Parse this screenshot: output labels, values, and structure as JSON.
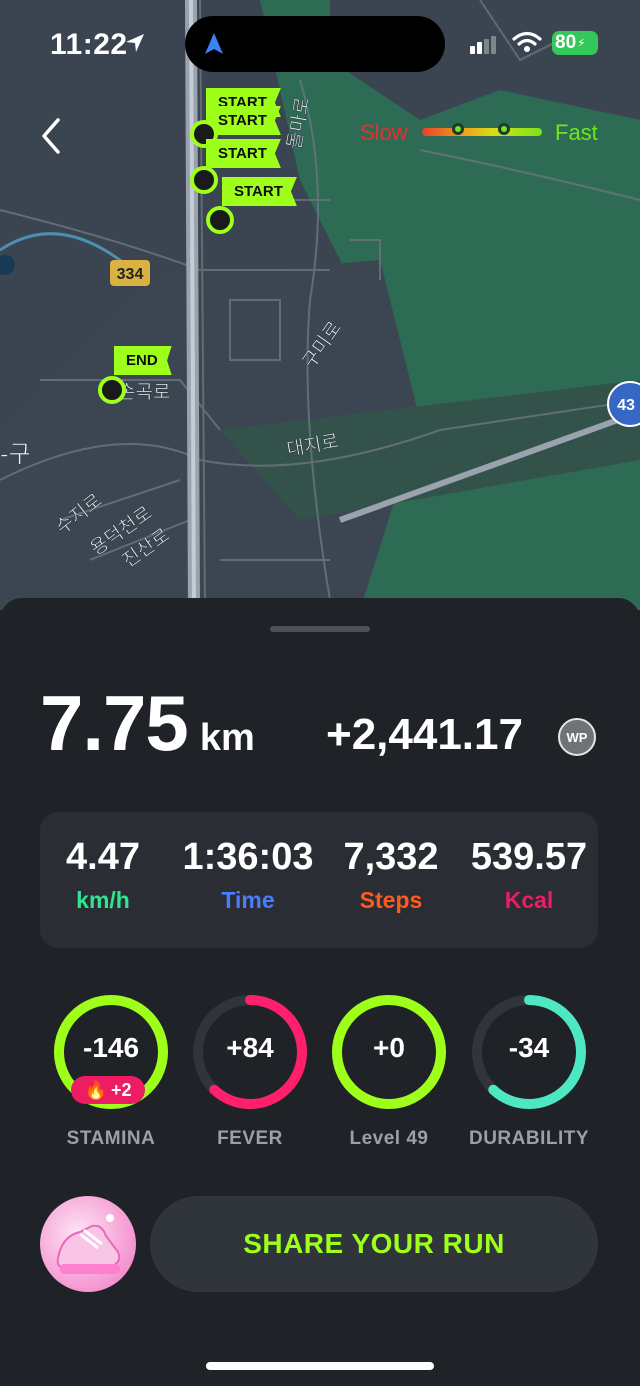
{
  "status_bar": {
    "time": "11:22",
    "battery": "80"
  },
  "map": {
    "route_labels": [
      "334",
      "43"
    ],
    "place_labels": [
      "손곡로",
      "대지로",
      "구미로",
      "돌마로",
      "수지로",
      "용덕천로",
      "진산로",
      "-구"
    ],
    "flags": {
      "start_1": "START",
      "start_2": "START",
      "start_3": "START",
      "start_4": "START",
      "end": "END"
    },
    "legend": {
      "slow": "Slow",
      "fast": "Fast"
    }
  },
  "summary": {
    "distance_value": "7.75",
    "distance_unit": "km",
    "points": "+2,441.17",
    "points_badge": "WP"
  },
  "stats": [
    {
      "value": "4.47",
      "label": "km/h",
      "color": "#2ee68f"
    },
    {
      "value": "1:36:03",
      "label": "Time",
      "color": "#4a7cff"
    },
    {
      "value": "7,332",
      "label": "Steps",
      "color": "#ff5a1f"
    },
    {
      "value": "539.57",
      "label": "Kcal",
      "color": "#ee1c63"
    }
  ],
  "rings": [
    {
      "value": "-146",
      "label": "STAMINA",
      "color": "#9dff1a",
      "fill": 1.0,
      "bonus": "+2"
    },
    {
      "value": "+84",
      "label": "FEVER",
      "color": "#ff1f6b",
      "fill": 0.62
    },
    {
      "value": "+0",
      "label": "Level 49",
      "color": "#9dff1a",
      "fill": 1.0
    },
    {
      "value": "-34",
      "label": "DURABILITY",
      "color": "#4de8c2",
      "fill": 0.62
    }
  ],
  "share_button": "SHARE YOUR RUN",
  "icons": [
    "location-arrow-icon",
    "navigation-icon",
    "signal-icon",
    "wifi-icon",
    "battery-icon",
    "back-chevron-icon",
    "fire-icon",
    "sneaker-avatar-icon"
  ]
}
